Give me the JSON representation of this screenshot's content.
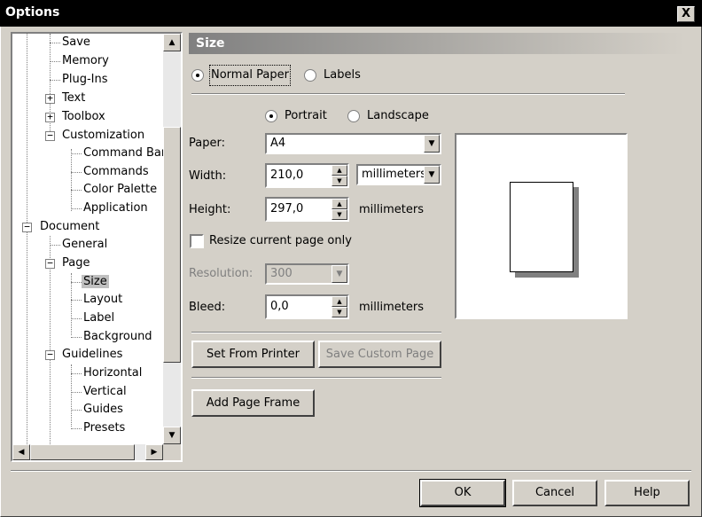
{
  "window": {
    "title": "Options",
    "close_label": "X"
  },
  "tree": {
    "items": [
      {
        "label": "Save"
      },
      {
        "label": "Memory"
      },
      {
        "label": "Plug-Ins"
      },
      {
        "label": "Text"
      },
      {
        "label": "Toolbox"
      },
      {
        "label": "Customization"
      },
      {
        "label": "Command Bars"
      },
      {
        "label": "Commands"
      },
      {
        "label": "Color Palette"
      },
      {
        "label": "Application"
      },
      {
        "label": "Document"
      },
      {
        "label": "General"
      },
      {
        "label": "Page"
      },
      {
        "label": "Size"
      },
      {
        "label": "Layout"
      },
      {
        "label": "Label"
      },
      {
        "label": "Background"
      },
      {
        "label": "Guidelines"
      },
      {
        "label": "Horizontal"
      },
      {
        "label": "Vertical"
      },
      {
        "label": "Guides"
      },
      {
        "label": "Presets"
      }
    ],
    "expand_glyph": "+",
    "collapse_glyph": "−"
  },
  "section": {
    "title": "Size"
  },
  "paper_type": {
    "normal_label": "Normal Paper",
    "labels_label": "Labels",
    "selected": "normal"
  },
  "orientation": {
    "portrait_label": "Portrait",
    "landscape_label": "Landscape",
    "selected": "portrait"
  },
  "fields": {
    "paper_label": "Paper:",
    "paper_value": "A4",
    "width_label": "Width:",
    "width_value": "210,0",
    "width_unit": "millimeters",
    "height_label": "Height:",
    "height_value": "297,0",
    "height_unit": "millimeters",
    "resize_label": "Resize current page only",
    "resize_checked": false,
    "resolution_label": "Resolution:",
    "resolution_value": "300",
    "bleed_label": "Bleed:",
    "bleed_value": "0,0",
    "bleed_unit": "millimeters"
  },
  "buttons": {
    "set_from_printer": "Set From Printer",
    "save_custom_page": "Save Custom Page",
    "add_page_frame": "Add Page Frame",
    "ok": "OK",
    "cancel": "Cancel",
    "help": "Help"
  },
  "icons": {
    "scroll_up": "▲",
    "scroll_down": "▼",
    "scroll_left": "◀",
    "scroll_right": "▶",
    "dropdown": "▼",
    "spin_up": "▲",
    "spin_down": "▼"
  }
}
